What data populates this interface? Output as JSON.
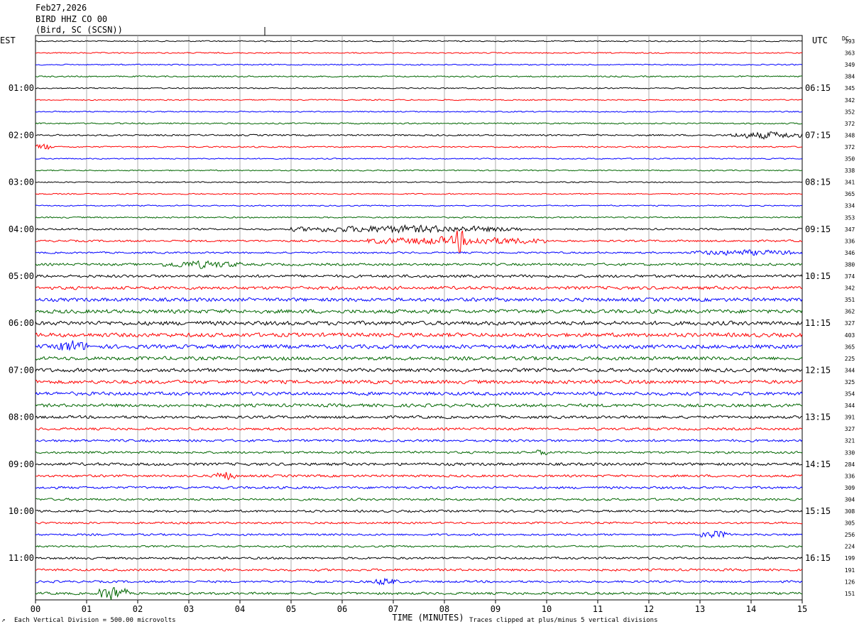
{
  "header": {
    "date": "Feb27,2026",
    "station": "BIRD HHZ CO 00",
    "location": "(Bird, SC (SCSN))"
  },
  "left_timezone": "EST",
  "right_timezone": "UTC",
  "dc_label": "DC",
  "footer": {
    "scale_note": "Each Vertical Division = 500.00 microvolts",
    "clip_note": "Traces clipped at plus/minus 5 vertical divisions",
    "corner_mark": "↗"
  },
  "chart_data": {
    "type": "line",
    "xlabel": "TIME (MINUTES)",
    "x_ticks": [
      "00",
      "01",
      "02",
      "03",
      "04",
      "05",
      "06",
      "07",
      "08",
      "09",
      "10",
      "11",
      "12",
      "13",
      "14",
      "15"
    ],
    "xlim": [
      0,
      15
    ],
    "trace_count": 48,
    "trace_colors": [
      "#000000",
      "#ff0000",
      "#0000ff",
      "#006600"
    ],
    "left_time_labels": [
      "01:00",
      "02:00",
      "03:00",
      "04:00",
      "05:00",
      "06:00",
      "07:00",
      "08:00",
      "09:00",
      "10:00",
      "11:00"
    ],
    "right_time_labels": [
      "06:15",
      "07:15",
      "08:15",
      "09:15",
      "10:15",
      "11:15",
      "12:15",
      "13:15",
      "14:15",
      "15:15",
      "16:15"
    ],
    "dc_values": [
      "393",
      "363",
      "349",
      "384",
      "345",
      "342",
      "352",
      "372",
      "348",
      "372",
      "350",
      "338",
      "341",
      "365",
      "334",
      "353",
      "347",
      "336",
      "346",
      "380",
      "374",
      "342",
      "351",
      "362",
      "327",
      "403",
      "365",
      "225",
      "344",
      "325",
      "354",
      "344",
      "391",
      "327",
      "321",
      "330",
      "284",
      "336",
      "309",
      "304",
      "308",
      "305",
      "256",
      "224",
      "199",
      "191",
      "126",
      "151"
    ],
    "trace_amplitudes": [
      0.3,
      0.3,
      0.3,
      0.35,
      0.3,
      0.3,
      0.3,
      0.35,
      0.4,
      0.35,
      0.3,
      0.3,
      0.3,
      0.3,
      0.3,
      0.35,
      0.45,
      0.5,
      0.45,
      0.6,
      0.7,
      0.8,
      0.9,
      0.95,
      1.0,
      1.0,
      1.0,
      0.9,
      0.9,
      0.9,
      0.85,
      0.8,
      0.7,
      0.6,
      0.6,
      0.55,
      0.7,
      0.6,
      0.6,
      0.55,
      0.55,
      0.5,
      0.5,
      0.45,
      0.55,
      0.55,
      0.55,
      0.6
    ],
    "events": [
      {
        "trace": 8,
        "start": 13.6,
        "end": 15.0,
        "strength": 4.0
      },
      {
        "trace": 9,
        "start": 0.0,
        "end": 0.35,
        "strength": 4.5
      },
      {
        "trace": 16,
        "start": 5.0,
        "end": 9.5,
        "strength": 3.5
      },
      {
        "trace": 17,
        "start": 6.5,
        "end": 10.0,
        "strength": 3.5
      },
      {
        "trace": 17,
        "start": 8.2,
        "end": 8.4,
        "strength": 9.0
      },
      {
        "trace": 18,
        "start": 12.8,
        "end": 15.0,
        "strength": 2.5
      },
      {
        "trace": 19,
        "start": 2.5,
        "end": 4.0,
        "strength": 2.5
      },
      {
        "trace": 26,
        "start": 0.4,
        "end": 1.0,
        "strength": 2.5
      },
      {
        "trace": 35,
        "start": 9.8,
        "end": 10.0,
        "strength": 3.0
      },
      {
        "trace": 37,
        "start": 3.5,
        "end": 3.9,
        "strength": 3.5
      },
      {
        "trace": 42,
        "start": 13.0,
        "end": 13.6,
        "strength": 3.5
      },
      {
        "trace": 47,
        "start": 1.2,
        "end": 1.8,
        "strength": 6.0
      },
      {
        "trace": 46,
        "start": 6.6,
        "end": 7.1,
        "strength": 3.0
      }
    ]
  }
}
